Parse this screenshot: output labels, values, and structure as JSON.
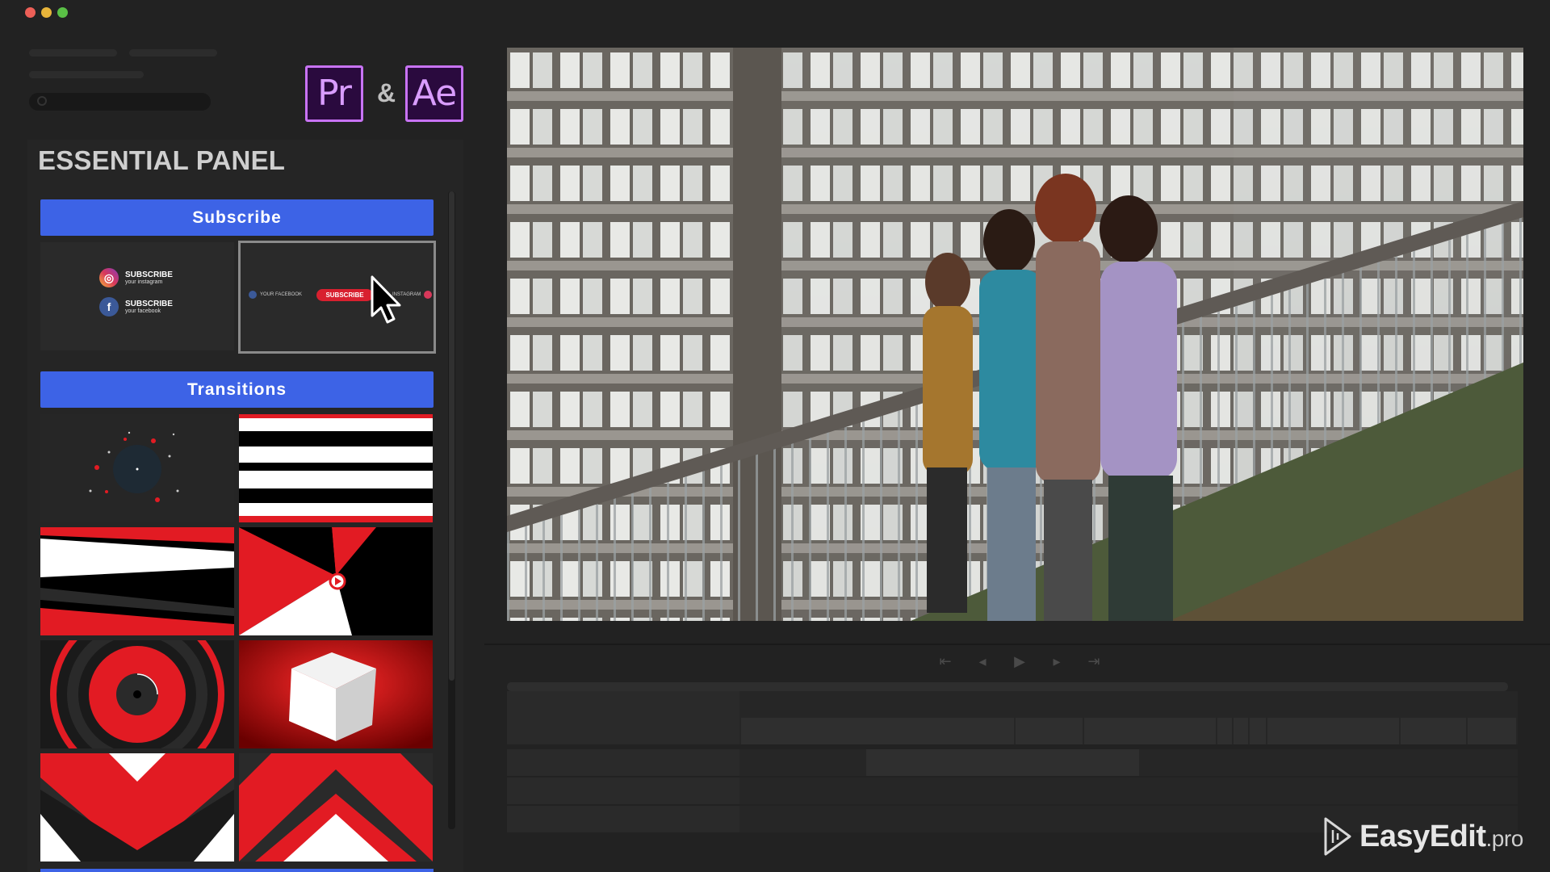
{
  "window": {
    "controls": [
      {
        "name": "close",
        "color": "#ed5f57"
      },
      {
        "name": "minimize",
        "color": "#e7b43a"
      },
      {
        "name": "maximize",
        "color": "#5ac046"
      }
    ]
  },
  "apps": {
    "premiere": "Pr",
    "ampersand": "&",
    "after_effects": "Ae",
    "logo_border_color": "#c873f5"
  },
  "panel": {
    "title": "ESSENTIAL PANEL",
    "accent_color": "#3d63e6",
    "subscribe": {
      "section_label": "Subscribe",
      "tile1": {
        "instagram_title": "SUBSCRIBE",
        "instagram_sub": "your instagram",
        "facebook_title": "SUBSCRIBE",
        "facebook_sub": "your facebook"
      },
      "tile2": {
        "facebook_label": "YOUR FACEBOOK",
        "button_label": "SUBSCRIBE",
        "instagram_label": "INSTAGRAM"
      }
    },
    "transitions": {
      "section_label": "Transitions",
      "items": [
        "dots-burst",
        "horizontal-stripes",
        "diagonal-wipe",
        "play-triangle",
        "red-rings",
        "white-cube",
        "chevron-down",
        "chevron-up"
      ]
    }
  },
  "viewer": {
    "description_icon": "preview-frame",
    "transport": [
      {
        "name": "go-to-start",
        "glyph": "⇤"
      },
      {
        "name": "step-back",
        "glyph": "◂"
      },
      {
        "name": "play",
        "glyph": "▶"
      },
      {
        "name": "step-forward",
        "glyph": "▸"
      },
      {
        "name": "go-to-end",
        "glyph": "⇥"
      }
    ]
  },
  "watermark": {
    "brand": "EasyEdit",
    "suffix": ".pro"
  }
}
